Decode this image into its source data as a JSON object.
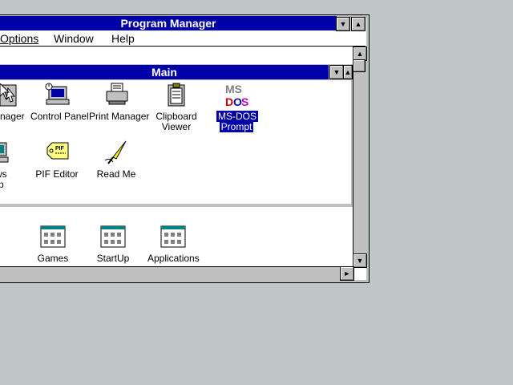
{
  "window": {
    "title": "Program Manager"
  },
  "menu": {
    "options": "Options",
    "window": "Window",
    "help": "Help"
  },
  "main_group": {
    "title": "Main",
    "icons": [
      {
        "label_line1": "anager",
        "label_line2": ""
      },
      {
        "label_line1": "Control Panel",
        "label_line2": ""
      },
      {
        "label_line1": "Print Manager",
        "label_line2": ""
      },
      {
        "label_line1": "Clipboard",
        "label_line2": "Viewer"
      },
      {
        "label_line1": "MS-DOS",
        "label_line2": "Prompt"
      },
      {
        "label_line1": "ows",
        "label_line2": "up"
      },
      {
        "label_line1": "PIF Editor",
        "label_line2": ""
      },
      {
        "label_line1": "Read Me",
        "label_line2": ""
      }
    ]
  },
  "groups": [
    {
      "label": "Games"
    },
    {
      "label": "StartUp"
    },
    {
      "label": "Applications"
    }
  ],
  "pif_tag_text": "PIF",
  "msdos_logo": "MS DOS",
  "colors": {
    "titlebar": "#0000a8",
    "desktop": "#c0c7c8",
    "face": "#c0c0c0"
  }
}
